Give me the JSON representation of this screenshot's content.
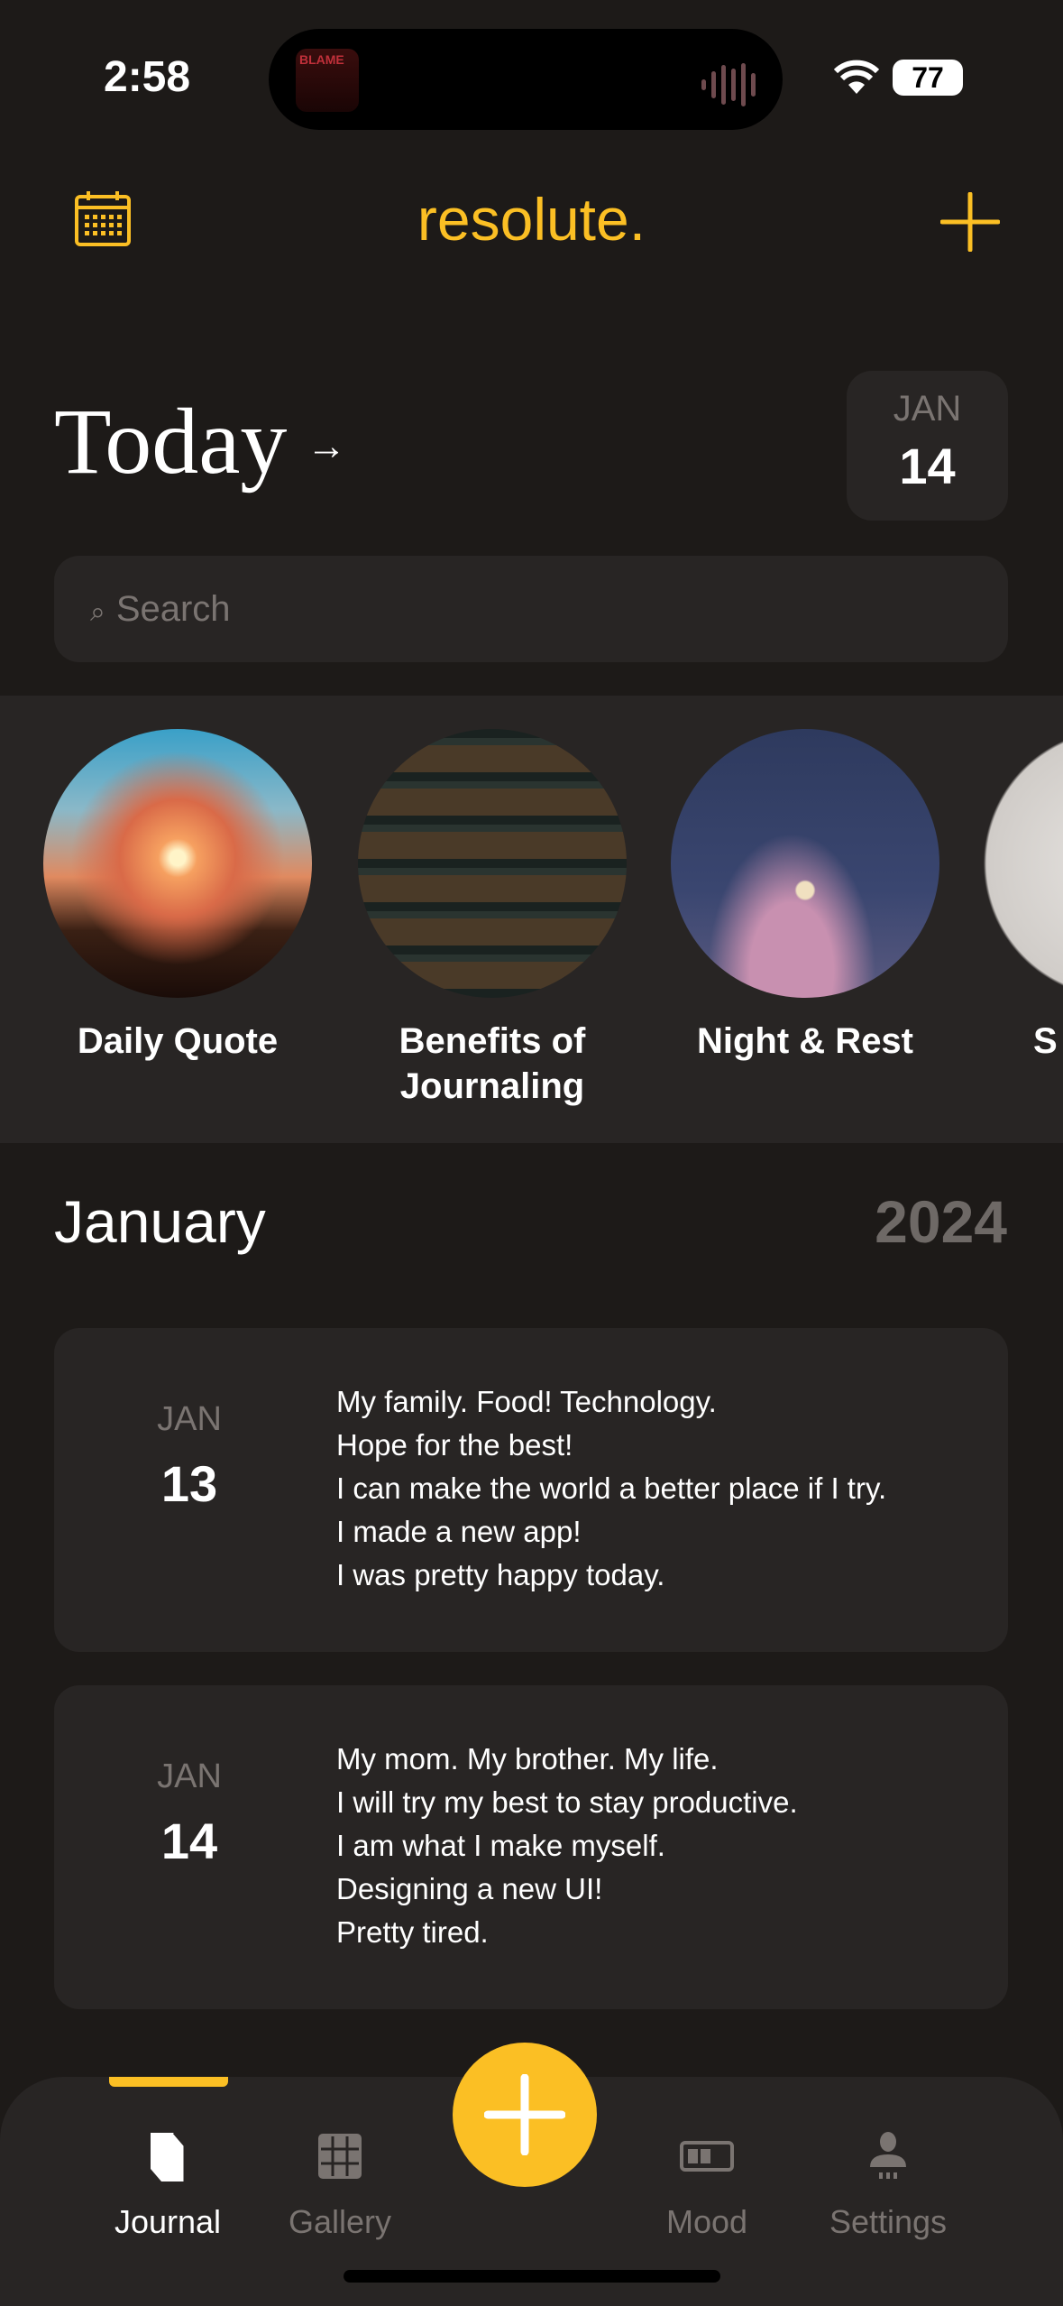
{
  "status": {
    "time": "2:58",
    "battery": "77",
    "album_text": "BLAME"
  },
  "header": {
    "title": "resolute.",
    "left_icon": "calendar-icon",
    "right_icon": "plus-icon",
    "accent": "#fbbf24"
  },
  "today": {
    "title": "Today",
    "arrow": "→",
    "date_month": "JAN",
    "date_day": "14"
  },
  "search": {
    "placeholder": "Search",
    "icon": "⌕"
  },
  "stories": [
    {
      "label": "Daily Quote"
    },
    {
      "label": "Benefits of Journaling"
    },
    {
      "label": "Night & Rest"
    },
    {
      "label": "S"
    }
  ],
  "section": {
    "month": "January",
    "year": "2024"
  },
  "entries": [
    {
      "month": "JAN",
      "day": "13",
      "lines": [
        "My family. Food! Technology.",
        "Hope for the best!",
        "I can make the world a better place if I try.",
        "I made a new app!",
        "I was pretty happy today."
      ]
    },
    {
      "month": "JAN",
      "day": "14",
      "lines": [
        "My mom. My brother. My life.",
        "I will try my best to stay productive.",
        "I am what I make myself.",
        "Designing a new UI!",
        "Pretty tired."
      ]
    }
  ],
  "tabs": [
    {
      "label": "Journal",
      "active": true
    },
    {
      "label": "Gallery"
    },
    {
      "label": "Mood"
    },
    {
      "label": "Settings"
    }
  ]
}
